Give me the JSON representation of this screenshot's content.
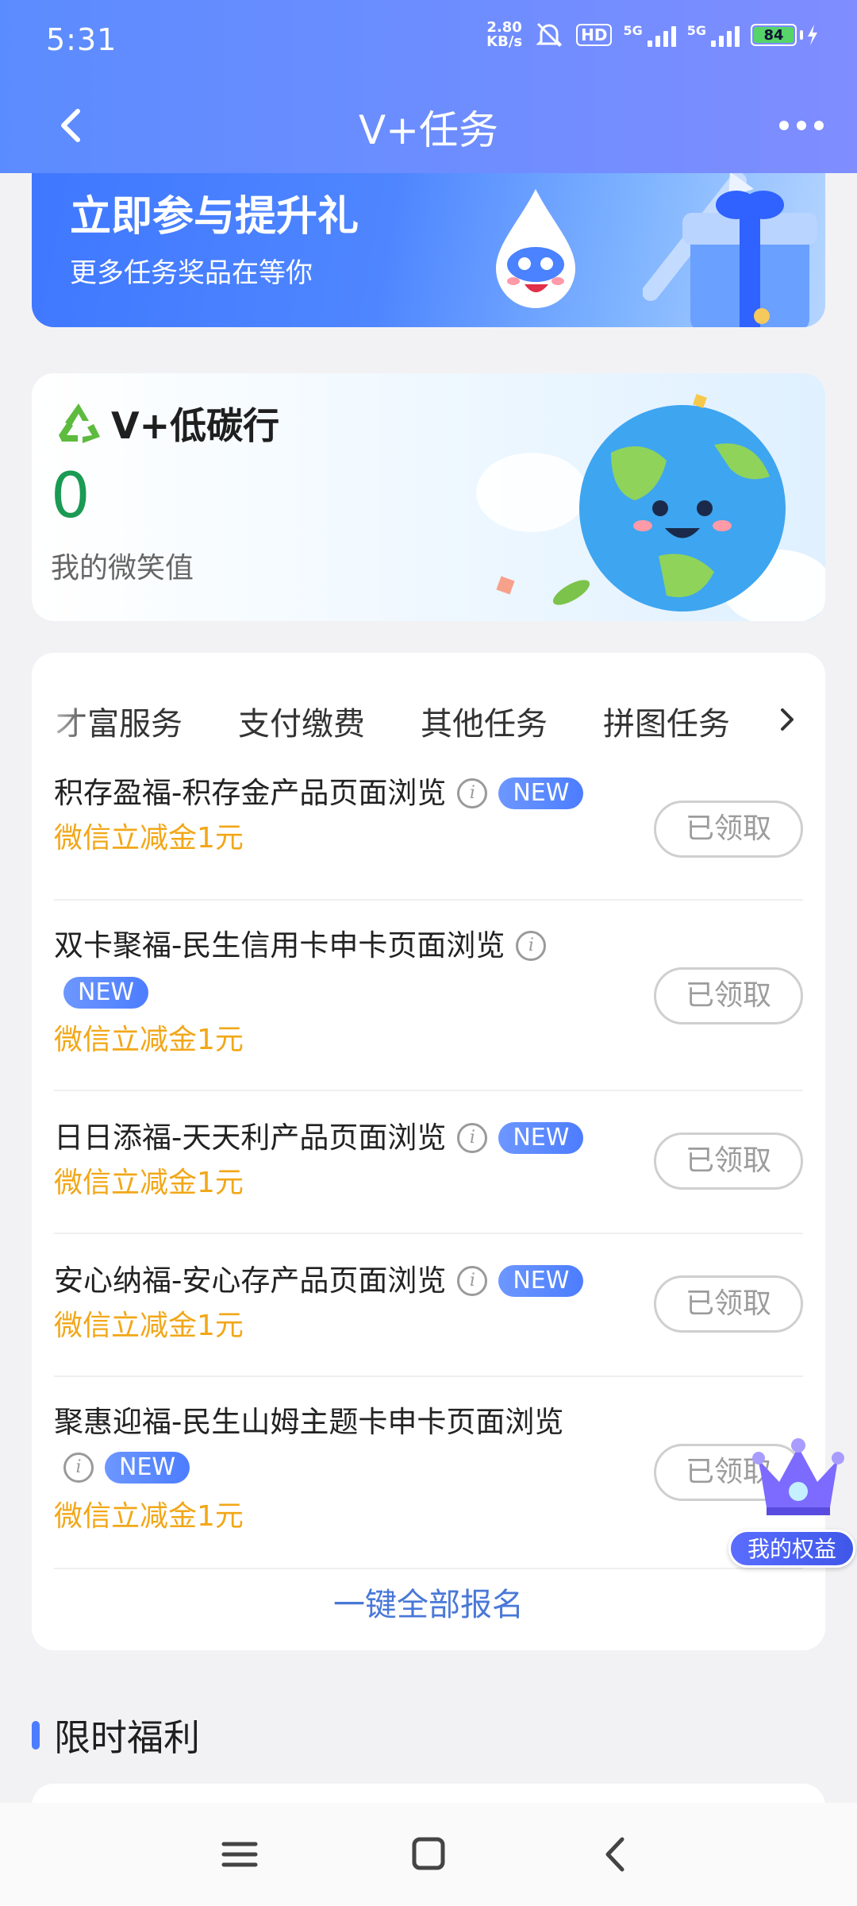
{
  "status": {
    "time": "5:31",
    "net_speed_value": "2.80",
    "net_speed_unit": "KB/s",
    "hd_label": "HD",
    "sig1_label": "5G",
    "sig2_label": "5G",
    "battery_level": "84"
  },
  "nav": {
    "title": "V+任务"
  },
  "promo": {
    "headline": "立即参与提升礼",
    "subline": "更多任务奖品在等你"
  },
  "carbon": {
    "title": "V+低碳行",
    "value": "0",
    "value_label": "我的微笑值"
  },
  "tabs": [
    "才富服务",
    "支付缴费",
    "其他任务",
    "拼图任务"
  ],
  "tasks": [
    {
      "name": "积存盈福-积存金产品页面浏览",
      "new": "NEW",
      "reward": "微信立减金1元",
      "button": "已领取"
    },
    {
      "name": "双卡聚福-民生信用卡申卡页面浏览",
      "new": "NEW",
      "reward": "微信立减金1元",
      "button": "已领取"
    },
    {
      "name": "日日添福-天天利产品页面浏览",
      "new": "NEW",
      "reward": "微信立减金1元",
      "button": "已领取"
    },
    {
      "name": "安心纳福-安心存产品页面浏览",
      "new": "NEW",
      "reward": "微信立减金1元",
      "button": "已领取"
    },
    {
      "name": "聚惠迎福-民生山姆主题卡申卡页面浏览",
      "new": "NEW",
      "reward": "微信立减金1元",
      "button": "已领取"
    }
  ],
  "signup_all": "一键全部报名",
  "benefit_label": "我的权益",
  "section_title": "限时福利",
  "colors": {
    "header": "#6c8dff",
    "reward": "#f2a718",
    "carbon_value": "#1a9a53",
    "new_tag": "#4c7dff",
    "link": "#4a78d8"
  },
  "icons": [
    "back-arrow-icon",
    "more-dots-icon",
    "recycle-icon",
    "info-icon",
    "chevron-right-icon",
    "crown-icon",
    "menu-icon",
    "home-square-icon",
    "back-triangle-icon"
  ]
}
